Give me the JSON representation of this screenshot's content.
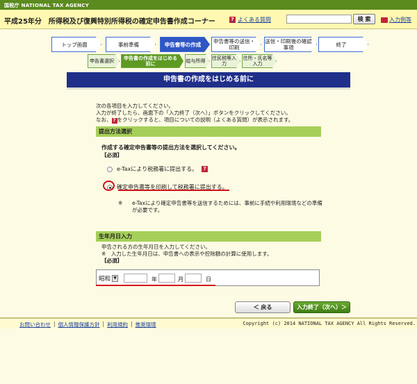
{
  "brand": "国税庁 NATIONAL TAX AGENCY",
  "header": {
    "title": "平成25年分　所得税及び復興特別所得税の確定申告書作成コーナー",
    "faq_label": "よくある質問",
    "search_label": "検 索",
    "usage_label": "入力例等"
  },
  "steps": [
    {
      "label": "トップ画面"
    },
    {
      "label": "事前準備"
    },
    {
      "label": "申告書等の作成"
    },
    {
      "label": "申告書等の送信・印刷"
    },
    {
      "label": "送信・印刷後の確認事項"
    },
    {
      "label": "終了"
    }
  ],
  "substeps": [
    {
      "label": "申告書選択"
    },
    {
      "label": "申告書の作成をはじめる前に"
    },
    {
      "label": "給与所得"
    },
    {
      "label": "住民税等入力"
    },
    {
      "label": "住所・氏名等入力"
    }
  ],
  "main": {
    "heading": "申告書の作成をはじめる前に",
    "intro_line1": "次の各項目を入力してください。",
    "intro_line2": "入力が終了したら、画面下の「入力終了（次へ）」ボタンをクリックしてください。",
    "intro_line3a": "なお、",
    "intro_line3b": "をクリックすると、項目についての説明（よくある質問）が表示されます。"
  },
  "submission": {
    "section_title": "提出方法選択",
    "question": "作成する確定申告書等の提出方法を選択してください。",
    "required": "【必須】",
    "option_etax": "e-Taxにより税務署に提出する。",
    "option_print": "確定申告書等を印刷して税務署に提出する。",
    "note_mark": "※",
    "note": "e-Taxにより確定申告書等を送信するためには、事前に手続や利用環境などの準備が必要です。"
  },
  "birth": {
    "section_title": "生年月日入力",
    "line1": "申告される方の生年月日を入力してください。",
    "line2": "※　入力した生年月日は、申告書への表示や控除額の計算に使用します。",
    "required": "【必須】",
    "era_value": "昭和",
    "year_label": "年",
    "month_label": "月",
    "day_label": "日"
  },
  "buttons": {
    "back": "＜ 戻る",
    "next": "入力終了（次へ）＞"
  },
  "footer": {
    "links": [
      "お問い合わせ",
      "個人情報保護方針",
      "利用規約",
      "推奨環境"
    ],
    "copyright": "Copyright (c) 2014 NATIONAL TAX AGENCY All Rights Reserved."
  }
}
